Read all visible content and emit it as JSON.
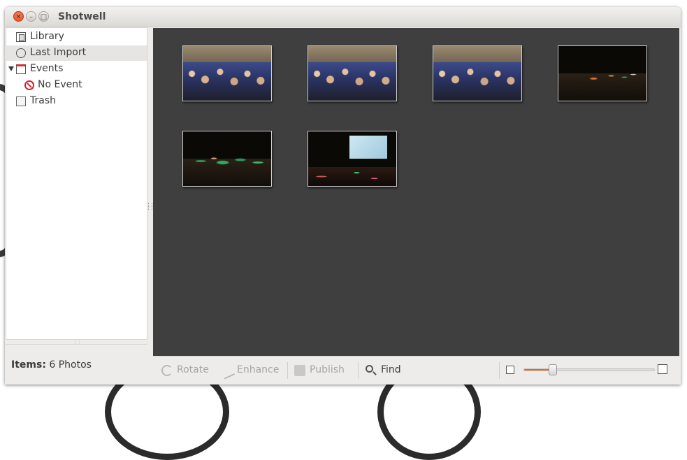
{
  "window": {
    "title": "Shotwell"
  },
  "sidebar": {
    "items": [
      {
        "label": "Library",
        "icon": "library-icon"
      },
      {
        "label": "Last Import",
        "icon": "last-import-icon",
        "selected": true
      },
      {
        "label": "Events",
        "icon": "events-icon",
        "expanded": true
      },
      {
        "label": "No Event",
        "icon": "no-event-icon"
      },
      {
        "label": "Trash",
        "icon": "trash-icon"
      }
    ]
  },
  "status": {
    "items_label": "Items:",
    "items_value": "6 Photos"
  },
  "photos": [
    {
      "kind": "crowd"
    },
    {
      "kind": "crowd"
    },
    {
      "kind": "crowd"
    },
    {
      "kind": "dark-stage"
    },
    {
      "kind": "dark-green"
    },
    {
      "kind": "screen"
    }
  ],
  "toolbar": {
    "rotate_label": "Rotate",
    "enhance_label": "Enhance",
    "publish_label": "Publish",
    "find_label": "Find",
    "zoom_level": 0.22
  },
  "colors": {
    "accent": "#e06c2c",
    "viewer_bg": "#3f3f3f",
    "close_button": "#e0481e"
  }
}
